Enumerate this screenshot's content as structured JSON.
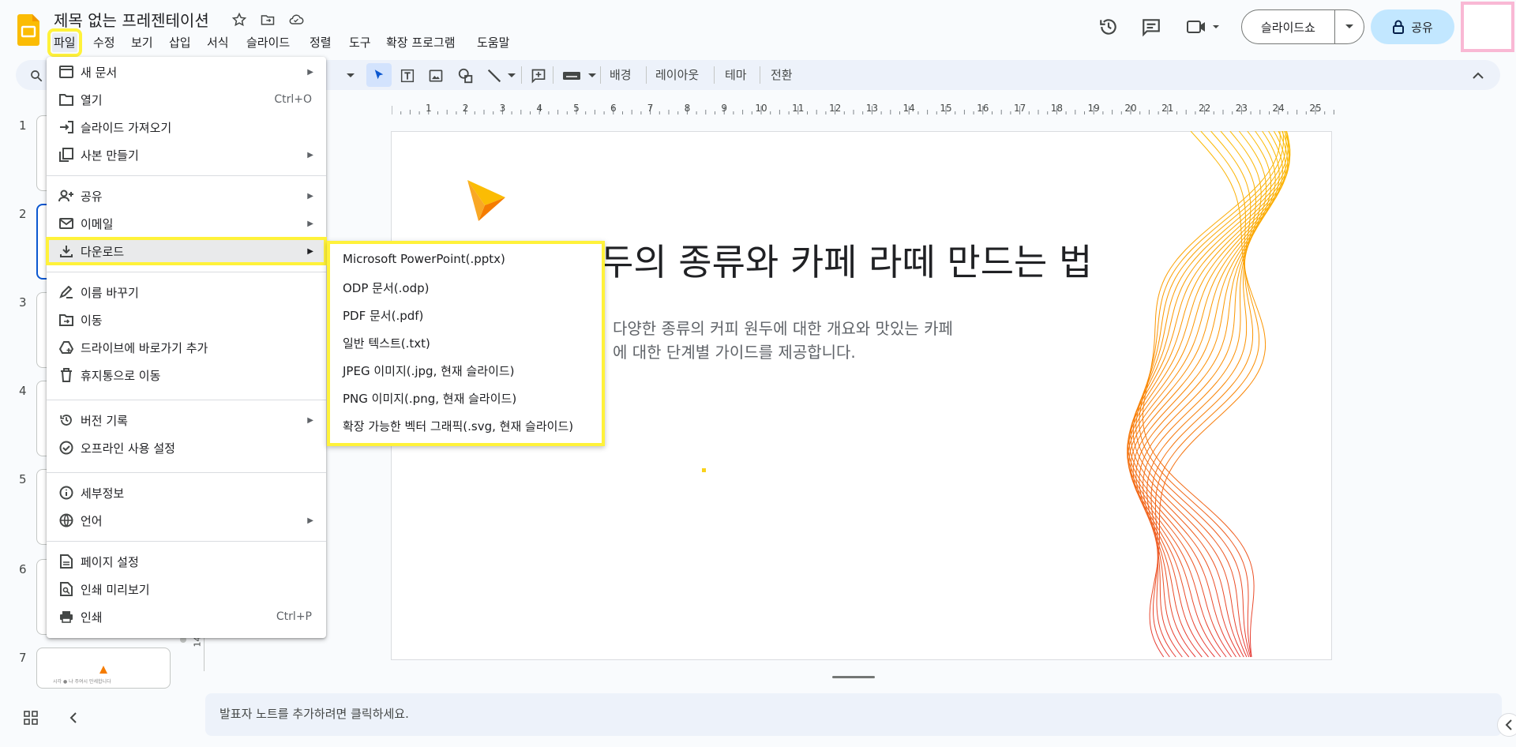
{
  "header": {
    "title": "제목 없는 프레젠테이션",
    "menus": [
      "파일",
      "수정",
      "보기",
      "삽입",
      "서식",
      "슬라이드",
      "정렬",
      "도구",
      "확장 프로그램",
      "도움말"
    ],
    "slideshow_label": "슬라이드쇼",
    "share_label": "공유"
  },
  "toolbar": {
    "background": "배경",
    "layout": "레이아웃",
    "theme": "테마",
    "transition": "전환"
  },
  "filmstrip": {
    "numbers": [
      "1",
      "2",
      "3",
      "4",
      "5",
      "6",
      "7"
    ],
    "thumb7_text": "시각 ● 냐 주여시 만세합니다"
  },
  "ruler": {
    "labels": [
      "1",
      "2",
      "3",
      "4",
      "5",
      "6",
      "7",
      "8",
      "9",
      "10",
      "11",
      "12",
      "13",
      "14",
      "15",
      "16",
      "17",
      "18",
      "19",
      "20",
      "21",
      "22",
      "23",
      "24",
      "25"
    ],
    "vertical_label": "14"
  },
  "slide": {
    "title": "두의 종류와 카페 라떼 만드는 법",
    "body_line1": "다양한 종류의 커피 원두에 대한 개요와 맛있는 카페",
    "body_line2": "에 대한 단계별 가이드를 제공합니다."
  },
  "notes": {
    "placeholder": "발표자 노트를 추가하려면 클릭하세요."
  },
  "file_menu": {
    "new": "새 문서",
    "open": "열기",
    "open_shortcut": "Ctrl+O",
    "import": "슬라이드 가져오기",
    "copy": "사본 만들기",
    "share": "공유",
    "email": "이메일",
    "download": "다운로드",
    "rename": "이름 바꾸기",
    "move": "이동",
    "shortcut": "드라이브에 바로가기 추가",
    "trash": "휴지통으로 이동",
    "version": "버전 기록",
    "offline": "오프라인 사용 설정",
    "details": "세부정보",
    "language": "언어",
    "page_setup": "페이지 설정",
    "print_preview": "인쇄 미리보기",
    "print": "인쇄",
    "print_shortcut": "Ctrl+P"
  },
  "download_menu": [
    "Microsoft PowerPoint(.pptx)",
    "ODP 문서(.odp)",
    "PDF 문서(.pdf)",
    "일반 텍스트(.txt)",
    "JPEG 이미지(.jpg, 현재 슬라이드)",
    "PNG 이미지(.png, 현재 슬라이드)",
    "확장 가능한 벡터 그래픽(.svg, 현재 슬라이드)"
  ],
  "colors": {
    "highlight": "#fff23a",
    "share_bg": "#c2e7ff",
    "accent": "#0b57d0",
    "slides_yellow": "#fbbc04"
  }
}
